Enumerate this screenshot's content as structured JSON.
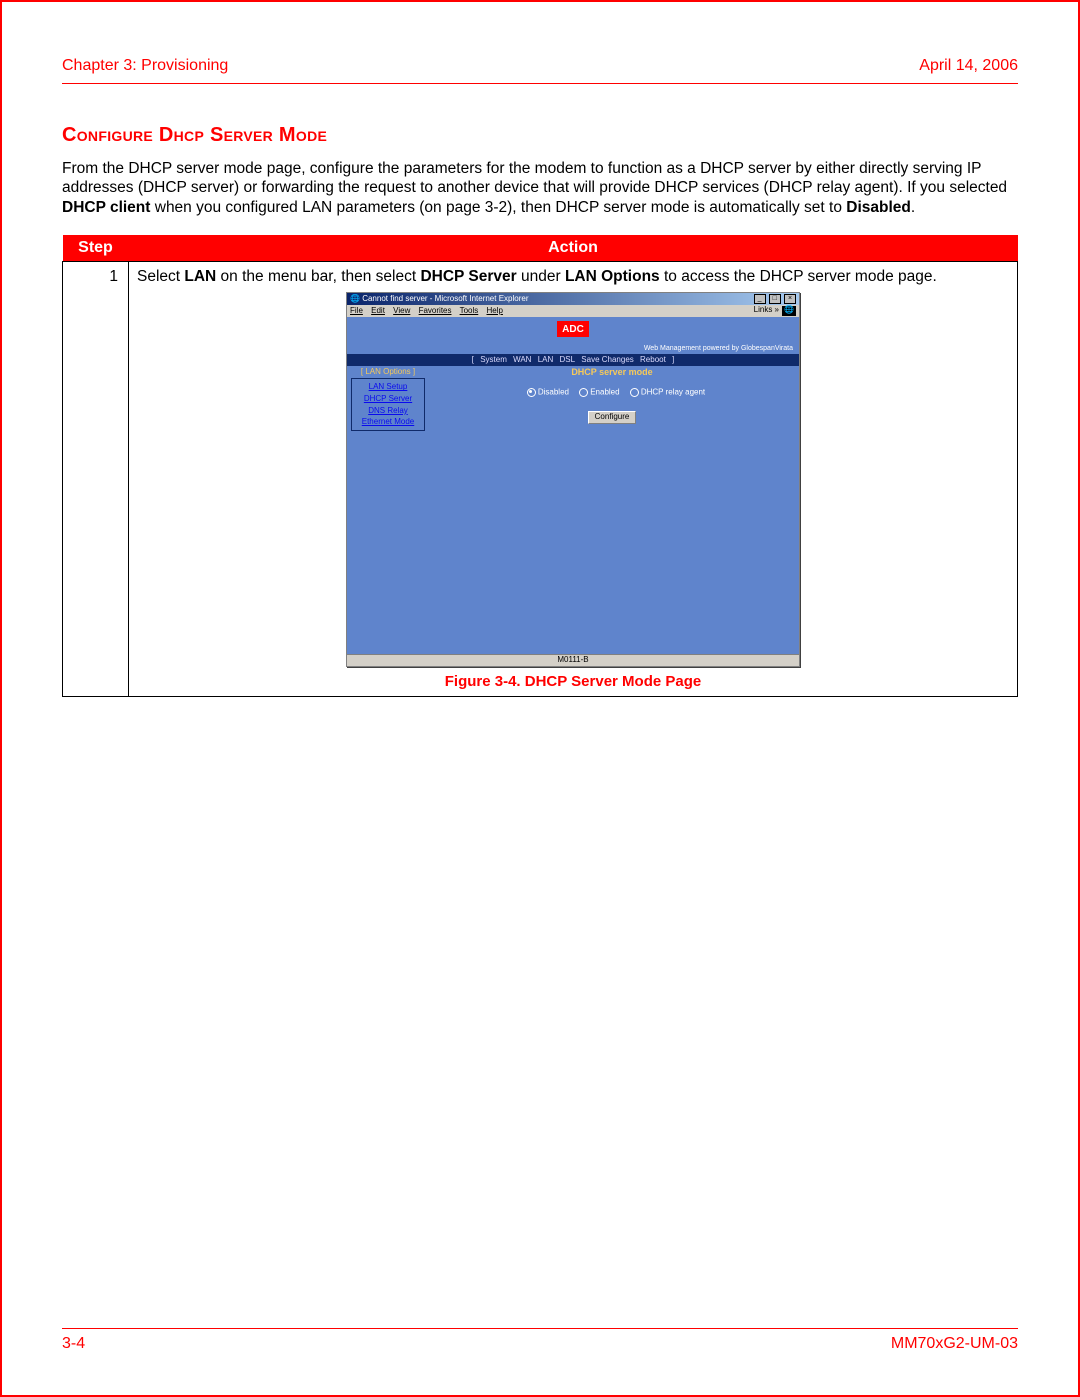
{
  "header": {
    "chapter": "Chapter 3: Provisioning",
    "date": "April 14, 2006"
  },
  "section_title": "Configure Dhcp Server Mode",
  "para": {
    "pre1": "From the DHCP server mode page, configure the parameters for the modem to function as a DHCP server by either directly serving IP addresses (DHCP server) or forwarding the request to another device that will provide DHCP services (DHCP relay agent). If you selected ",
    "b1": "DHCP client",
    "mid1": " when you configured LAN parameters (on page 3-2), then DHCP server mode is automatically set to ",
    "b2": "Disabled",
    "end": "."
  },
  "table": {
    "headers": {
      "step": "Step",
      "action": "Action"
    },
    "row1": {
      "num": "1",
      "p1": "Select ",
      "b1": "LAN",
      "p2": " on the menu bar, then select ",
      "b2": "DHCP Server",
      "p3": " under ",
      "b3": "LAN Options",
      "p4": " to access the DHCP server mode page."
    }
  },
  "figure_caption": "Figure 3-4. DHCP Server Mode Page",
  "screenshot": {
    "title": "Cannot find server - Microsoft Internet Explorer",
    "menus": [
      "File",
      "Edit",
      "View",
      "Favorites",
      "Tools",
      "Help"
    ],
    "links_label": "Links »",
    "logo": "ADC",
    "powered": "Web Management powered by GlobespanVirata",
    "nav": [
      "System",
      "WAN",
      "LAN",
      "DSL",
      "Save Changes",
      "Reboot"
    ],
    "sidebar_head": "[ LAN Options ]",
    "sidebar": [
      "LAN Setup",
      "DHCP Server",
      "DNS Relay",
      "Ethernet Mode"
    ],
    "panel_title": "DHCP server mode",
    "radios": [
      {
        "label": "Disabled",
        "selected": true
      },
      {
        "label": "Enabled",
        "selected": false
      },
      {
        "label": "DHCP relay agent",
        "selected": false
      }
    ],
    "configure_btn": "Configure",
    "status": "M0111-B"
  },
  "footer": {
    "page": "3-4",
    "docnum": "MM70xG2-UM-03"
  }
}
